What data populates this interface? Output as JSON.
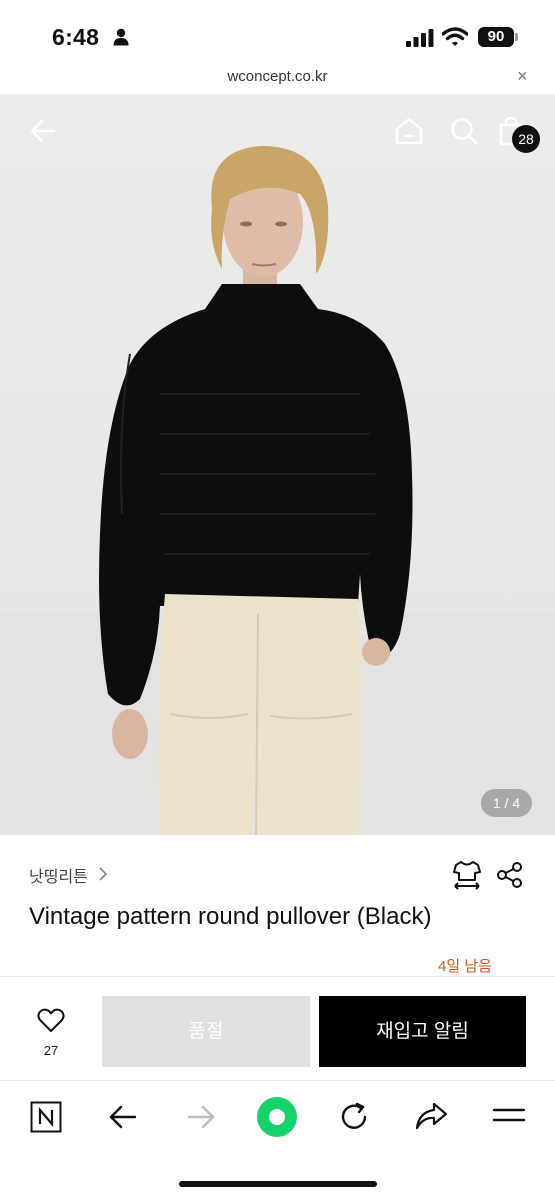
{
  "status_bar": {
    "time": "6:48",
    "battery": "90"
  },
  "browser": {
    "url": "wconcept.co.kr",
    "close_label": "×"
  },
  "header": {
    "cart_count": "28"
  },
  "gallery": {
    "pager": "1 / 4"
  },
  "product": {
    "brand": "낫띵리튼",
    "title": "Vintage pattern round pullover (Black)",
    "remaining": "4일 남음"
  },
  "actions": {
    "like_count": "27",
    "soldout_label": "품절",
    "restock_label": "재입고 알림"
  },
  "icons": {
    "back": "arrow-left-icon",
    "home": "home-icon",
    "search": "search-icon",
    "bag": "shopping-bag-icon",
    "size": "size-guide-icon",
    "share": "share-icon",
    "like": "heart-icon"
  },
  "colors": {
    "accent": "#d3541c",
    "sold_out_bg": "#e0e0e0",
    "primary_btn": "#000000",
    "toolbar_green": "#17d26b"
  }
}
